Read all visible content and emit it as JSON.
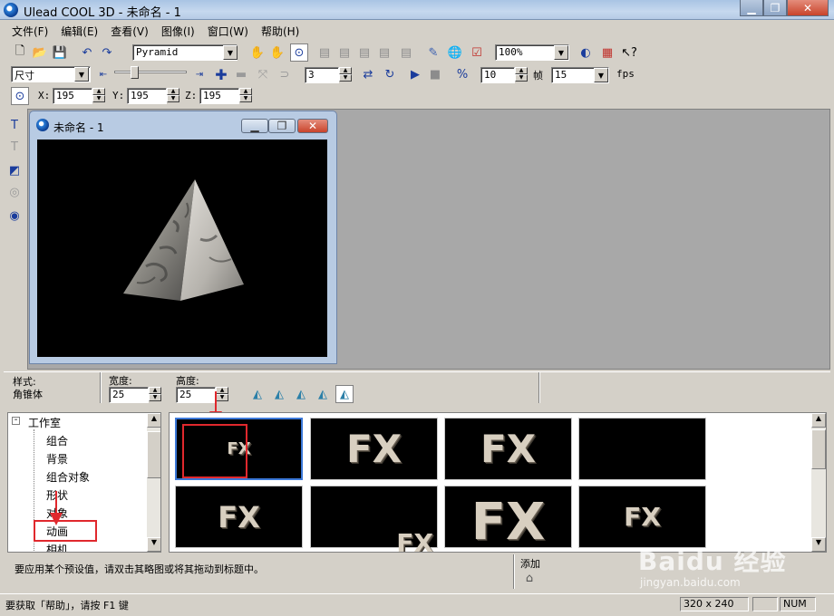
{
  "window": {
    "title": "Ulead COOL 3D - 未命名 - 1"
  },
  "menu": [
    "文件(F)",
    "编辑(E)",
    "查看(V)",
    "图像(I)",
    "窗口(W)",
    "帮助(H)"
  ],
  "toolbar1": {
    "object_select": "Pyramid",
    "zoom": "100%"
  },
  "toolbar2": {
    "attribute_select": "尺寸",
    "frame_value": "3",
    "frames_total": "10",
    "frames_label": "帧",
    "fps_value": "15",
    "fps_label": "fps"
  },
  "toolbar3": {
    "x_label": "X:",
    "x_value": "195",
    "y_label": "Y:",
    "y_value": "195",
    "z_label": "Z:",
    "z_value": "195"
  },
  "document": {
    "title": "未命名 - 1"
  },
  "props": {
    "style_label": "样式:",
    "style_value": "角锥体",
    "width_label": "宽度:",
    "width_value": "25",
    "height_label": "高度:",
    "height_value": "25"
  },
  "tree": {
    "root": "工作室",
    "items": [
      "组合",
      "背景",
      "组合对象",
      "形状",
      "对象",
      "动画",
      "相机"
    ]
  },
  "gallery": {
    "thumbs": [
      "FX",
      "FX",
      "FX",
      "",
      "FX",
      "FX",
      "FX",
      "FX"
    ]
  },
  "hint": {
    "text": "要应用某个预设值，请双击其略图或将其拖动到标题中。",
    "add_label": "添加"
  },
  "status": {
    "help": "要获取「帮助」，请按 F1 键",
    "size": "320 x 240",
    "num": "NUM"
  },
  "watermark": {
    "brand": "Baidu 经验",
    "url": "jingyan.baidu.com"
  },
  "colors": {
    "highlight": "#e0282d",
    "workspace": "#a8a8a8"
  }
}
